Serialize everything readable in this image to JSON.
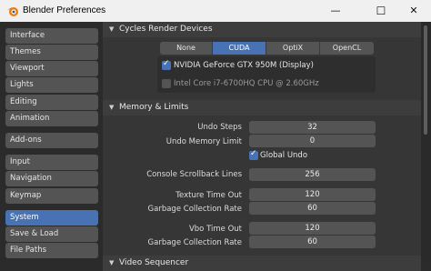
{
  "window": {
    "title": "Blender Preferences",
    "minimize_glyph": "—",
    "maximize_glyph": "☐",
    "close_glyph": "✕"
  },
  "sidebar": {
    "items": [
      {
        "label": "Interface"
      },
      {
        "label": "Themes"
      },
      {
        "label": "Viewport"
      },
      {
        "label": "Lights"
      },
      {
        "label": "Editing"
      },
      {
        "label": "Animation"
      },
      {
        "label": "Add-ons"
      },
      {
        "label": "Input"
      },
      {
        "label": "Navigation"
      },
      {
        "label": "Keymap"
      },
      {
        "label": "System",
        "active": true
      },
      {
        "label": "Save & Load"
      },
      {
        "label": "File Paths"
      }
    ]
  },
  "cycles": {
    "header": "Cycles Render Devices",
    "tabs": [
      "None",
      "CUDA",
      "OptiX",
      "OpenCL"
    ],
    "active_tab": "CUDA",
    "devices": [
      {
        "label": "NVIDIA GeForce GTX 950M (Display)",
        "checked": true
      },
      {
        "label": "Intel Core i7-6700HQ CPU @ 2.60GHz",
        "checked": false
      }
    ]
  },
  "memory": {
    "header": "Memory & Limits",
    "undo_steps": {
      "label": "Undo Steps",
      "value": "32"
    },
    "undo_memory_limit": {
      "label": "Undo Memory Limit",
      "value": "0"
    },
    "global_undo": {
      "label": "Global Undo",
      "checked": true
    },
    "console_scrollback": {
      "label": "Console Scrollback Lines",
      "value": "256"
    },
    "texture_time_out": {
      "label": "Texture Time Out",
      "value": "120"
    },
    "texture_gc_rate": {
      "label": "Garbage Collection Rate",
      "value": "60"
    },
    "vbo_time_out": {
      "label": "Vbo Time Out",
      "value": "120"
    },
    "vbo_gc_rate": {
      "label": "Garbage Collection Rate",
      "value": "60"
    }
  },
  "video": {
    "header": "Video Sequencer"
  },
  "colors": {
    "accent": "#4772b3",
    "button": "#545454",
    "panel": "#363636"
  }
}
